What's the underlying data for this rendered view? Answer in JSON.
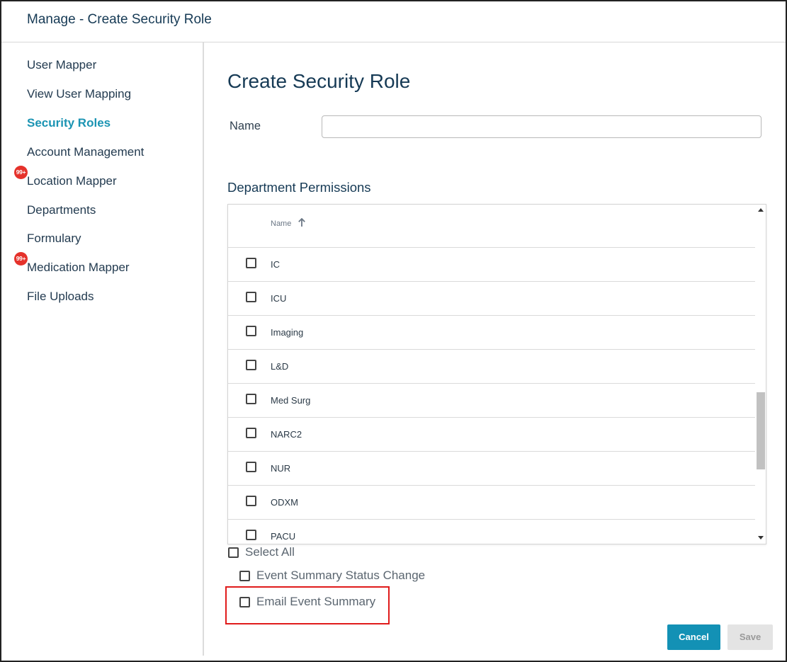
{
  "window": {
    "title": "Manage - Create Security Role"
  },
  "sidebar": {
    "items": [
      {
        "label": "User Mapper",
        "active": false,
        "badge": null
      },
      {
        "label": "View User Mapping",
        "active": false,
        "badge": null
      },
      {
        "label": "Security Roles",
        "active": true,
        "badge": null
      },
      {
        "label": "Account Management",
        "active": false,
        "badge": null
      },
      {
        "label": "Location Mapper",
        "active": false,
        "badge": "99+"
      },
      {
        "label": "Departments",
        "active": false,
        "badge": null
      },
      {
        "label": "Formulary",
        "active": false,
        "badge": null
      },
      {
        "label": "Medication Mapper",
        "active": false,
        "badge": "99+"
      },
      {
        "label": "File Uploads",
        "active": false,
        "badge": null
      }
    ]
  },
  "main": {
    "title": "Create Security Role",
    "name_label": "Name",
    "name_value": "",
    "department_permissions": {
      "title": "Department Permissions",
      "column_header": "Name",
      "sort": "ascending",
      "rows": [
        {
          "label": "IC",
          "checked": false
        },
        {
          "label": "ICU",
          "checked": false
        },
        {
          "label": "Imaging",
          "checked": false
        },
        {
          "label": "L&D",
          "checked": false
        },
        {
          "label": "Med Surg",
          "checked": false
        },
        {
          "label": "NARC2",
          "checked": false
        },
        {
          "label": "NUR",
          "checked": false
        },
        {
          "label": "ODXM",
          "checked": false
        },
        {
          "label": "PACU",
          "checked": false
        }
      ]
    },
    "select_all_label": "Select All",
    "event_summary_status_change_label": "Event Summary Status Change",
    "email_event_summary_label": "Email Event Summary"
  },
  "buttons": {
    "cancel": "Cancel",
    "save": "Save"
  },
  "colors": {
    "accent": "#1391b5",
    "active_nav": "#1b94b3",
    "badge": "#e5322b",
    "highlight": "#e01b1b",
    "heading": "#163a55"
  }
}
